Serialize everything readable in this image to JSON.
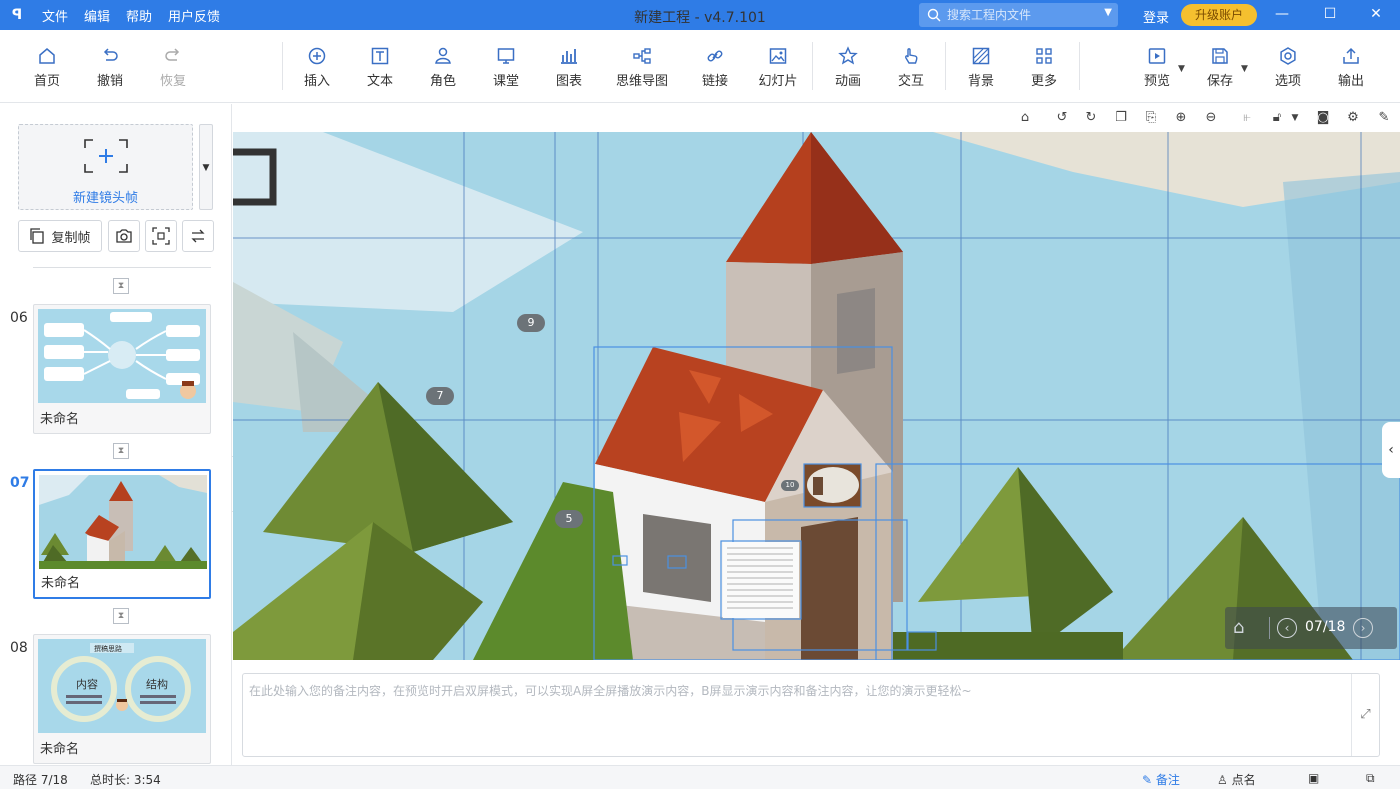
{
  "titlebar": {
    "logo": "ꟼ",
    "menu": [
      "文件",
      "编辑",
      "帮助",
      "用户反馈"
    ],
    "title": "新建工程 - v4.7.101",
    "search_placeholder": "搜索工程内文件",
    "login": "登录",
    "upgrade": "升级账户"
  },
  "toolbar": {
    "home": "首页",
    "undo": "撤销",
    "redo": "恢复",
    "insert": "插入",
    "text": "文本",
    "role": "角色",
    "classroom": "课堂",
    "chart": "图表",
    "mindmap": "思维导图",
    "link": "链接",
    "slide": "幻灯片",
    "animation": "动画",
    "interact": "交互",
    "background": "背景",
    "more": "更多",
    "preview": "预览",
    "save": "保存",
    "options": "选项",
    "export": "输出"
  },
  "leftpanel": {
    "new_frame": "新建镜头帧",
    "copy_frame": "复制帧",
    "slides": [
      {
        "num": "06",
        "name": "未命名"
      },
      {
        "num": "07",
        "name": "未命名"
      },
      {
        "num": "08",
        "name": "未命名"
      }
    ],
    "thumb8": {
      "title": "撰稿思路",
      "left": "内容",
      "right": "结构"
    }
  },
  "canvas": {
    "badges": [
      "9",
      "7",
      "5",
      "10"
    ],
    "page_indicator": "07/18"
  },
  "notes": {
    "placeholder": "在此处输入您的备注内容，在预览时开启双屏模式，可以实现A屏全屏播放演示内容，B屏显示演示内容和备注内容，让您的演示更轻松~"
  },
  "statusbar": {
    "path": "路径 7/18",
    "duration": "总时长: 3:54",
    "notes": "备注",
    "rollcall": "点名"
  }
}
